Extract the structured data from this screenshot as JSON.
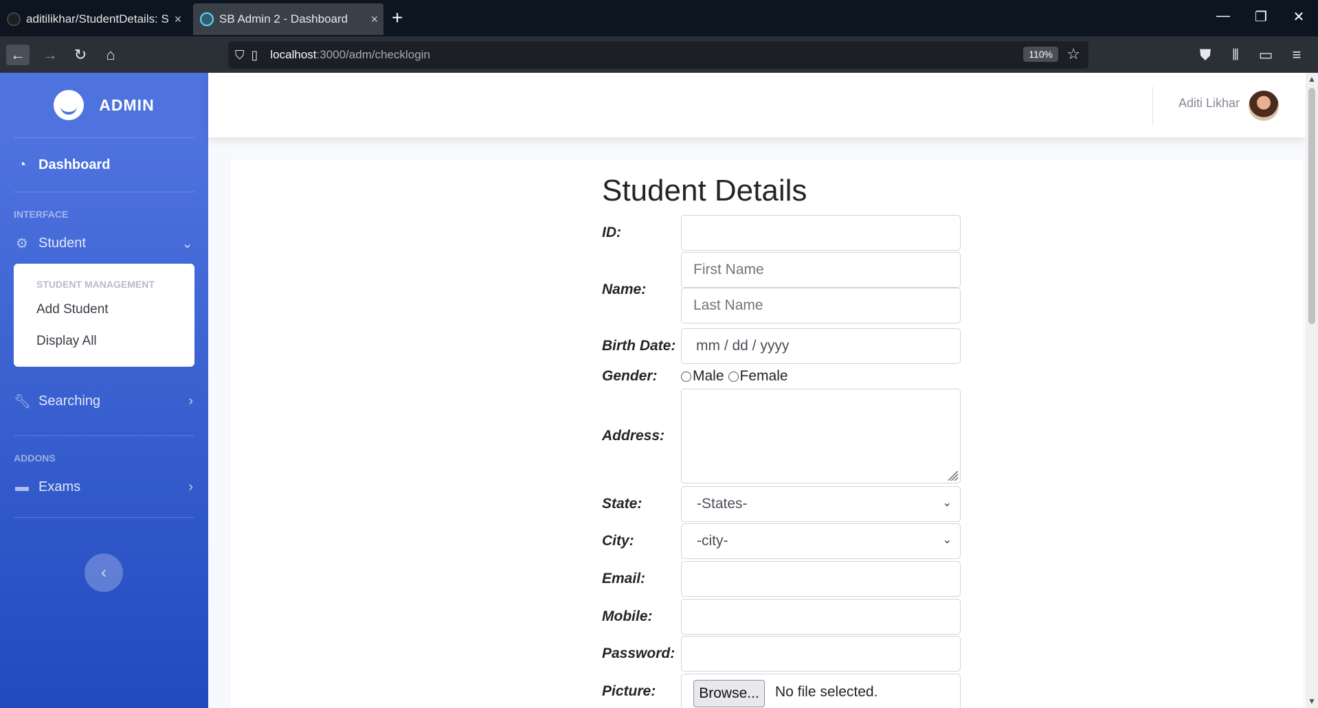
{
  "browser": {
    "tabs": [
      {
        "title": "aditilikhar/StudentDetails: Stude",
        "close": "×"
      },
      {
        "title": "SB Admin 2 - Dashboard",
        "close": "×"
      }
    ],
    "new_tab": "+",
    "window_controls": {
      "minimize": "—",
      "restore": "❐",
      "close": "✕"
    },
    "url_host": "localhost",
    "url_path": ":3000/adm/checklogin",
    "zoom": "110%"
  },
  "sidebar": {
    "brand": "ADMIN",
    "dashboard": "Dashboard",
    "interface_heading": "INTERFACE",
    "student": "Student",
    "collapse": {
      "heading": "STUDENT MANAGEMENT",
      "items": [
        "Add Student",
        "Display All"
      ]
    },
    "searching": "Searching",
    "addons_heading": "ADDONS",
    "exams": "Exams",
    "toggle": "‹"
  },
  "topbar": {
    "user_name": "Aditi Likhar"
  },
  "form": {
    "title": "Student Details",
    "labels": {
      "id": "ID:",
      "name": "Name:",
      "birth_date": "Birth Date:",
      "gender": "Gender:",
      "address": "Address:",
      "state": "State:",
      "city": "City:",
      "email": "Email:",
      "mobile": "Mobile:",
      "password": "Password:",
      "picture": "Picture:"
    },
    "placeholders": {
      "first_name": "First Name",
      "last_name": "Last Name",
      "birth_date": "mm / dd / yyyy"
    },
    "gender_options": [
      "Male",
      "Female"
    ],
    "state_selected": "-States-",
    "city_selected": "-city-",
    "browse_label": "Browse...",
    "file_status": "No file selected."
  }
}
